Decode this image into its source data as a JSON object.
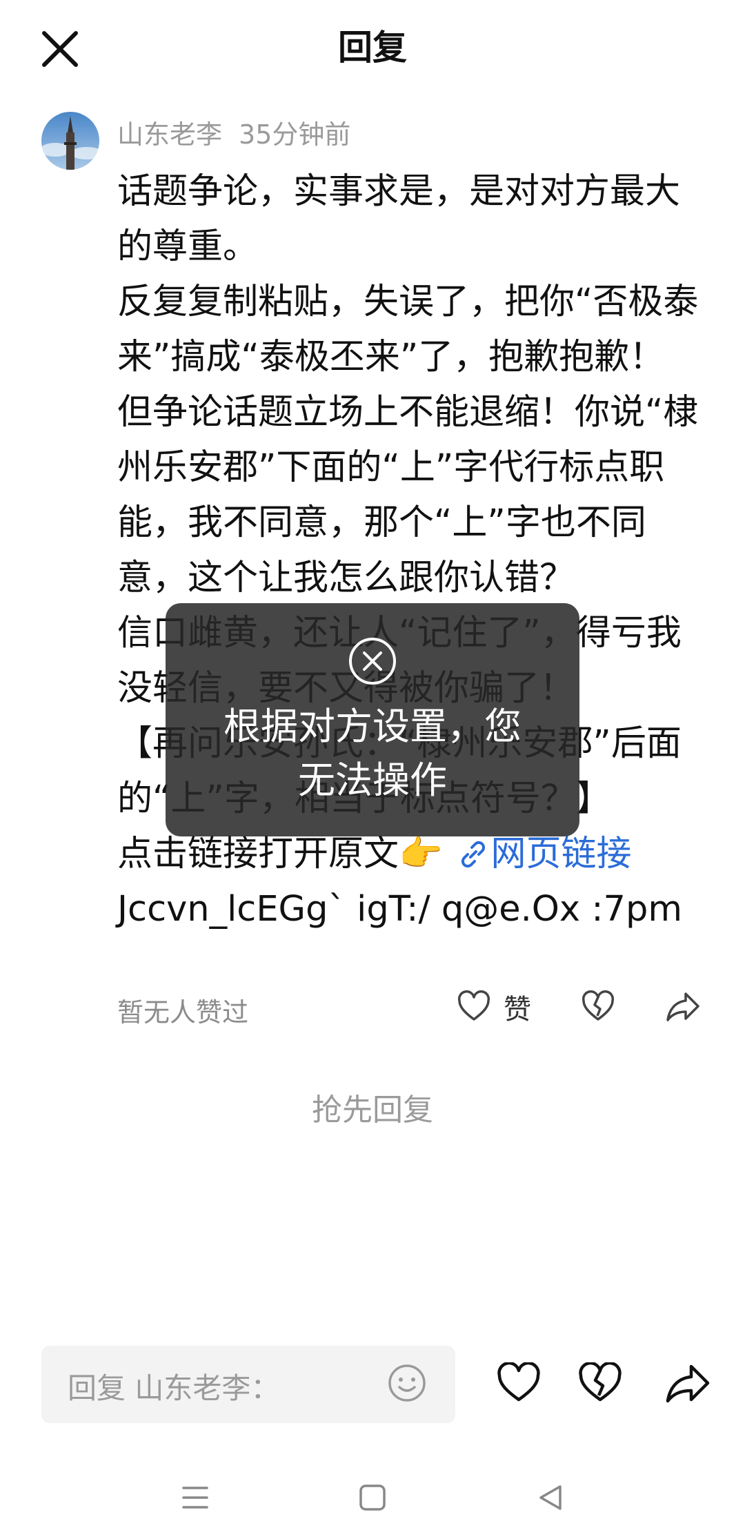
{
  "header": {
    "title": "回复"
  },
  "comment": {
    "author": "山东老李",
    "time": "35分钟前",
    "paragraphs": [
      "话题争论，实事求是，是对对方最大的尊重。",
      "反复复制粘贴，失误了，把你“否极泰来”搞成“泰极丕来”了，抱歉抱歉！",
      "但争论话题立场上不能退缩！你说“棣州乐安郡”下面的“上”字代行标点职能，我不同意，那个“上”字也不同意，这个让我怎么跟你认错？",
      "信口雌黄，还让人“记住了”，得亏我没轻信，要不又得被你骗了！",
      "【再问乐安孙氏：“棣州乐安郡”后面的“上”字，相当于标点符号？】"
    ],
    "link_prefix": "点击链接打开原文👉",
    "link_label": "网页链接",
    "code_line": "Jccvn_lcEGg` igT:/ q@e.Ox :7pm"
  },
  "actions": {
    "no_likes": "暂无人赞过",
    "like_label": "赞"
  },
  "first_reply": "抢先回复",
  "toast": {
    "message_line1": "根据对方设置，您",
    "message_line2": "无法操作"
  },
  "reply_bar": {
    "placeholder": "回复 山东老李："
  },
  "icons": {
    "close": "close-icon",
    "like": "heart-icon",
    "dislike": "broken-heart-icon",
    "share": "share-icon",
    "emoji": "smiley-icon",
    "link": "link-icon",
    "toast": "circle-x-icon",
    "nav_menu": "menu-icon",
    "nav_home": "home-square-icon",
    "nav_back": "back-triangle-icon"
  },
  "colors": {
    "link": "#2b6cd8",
    "meta_text": "#9a9a9a",
    "toast_bg": "#282828"
  }
}
